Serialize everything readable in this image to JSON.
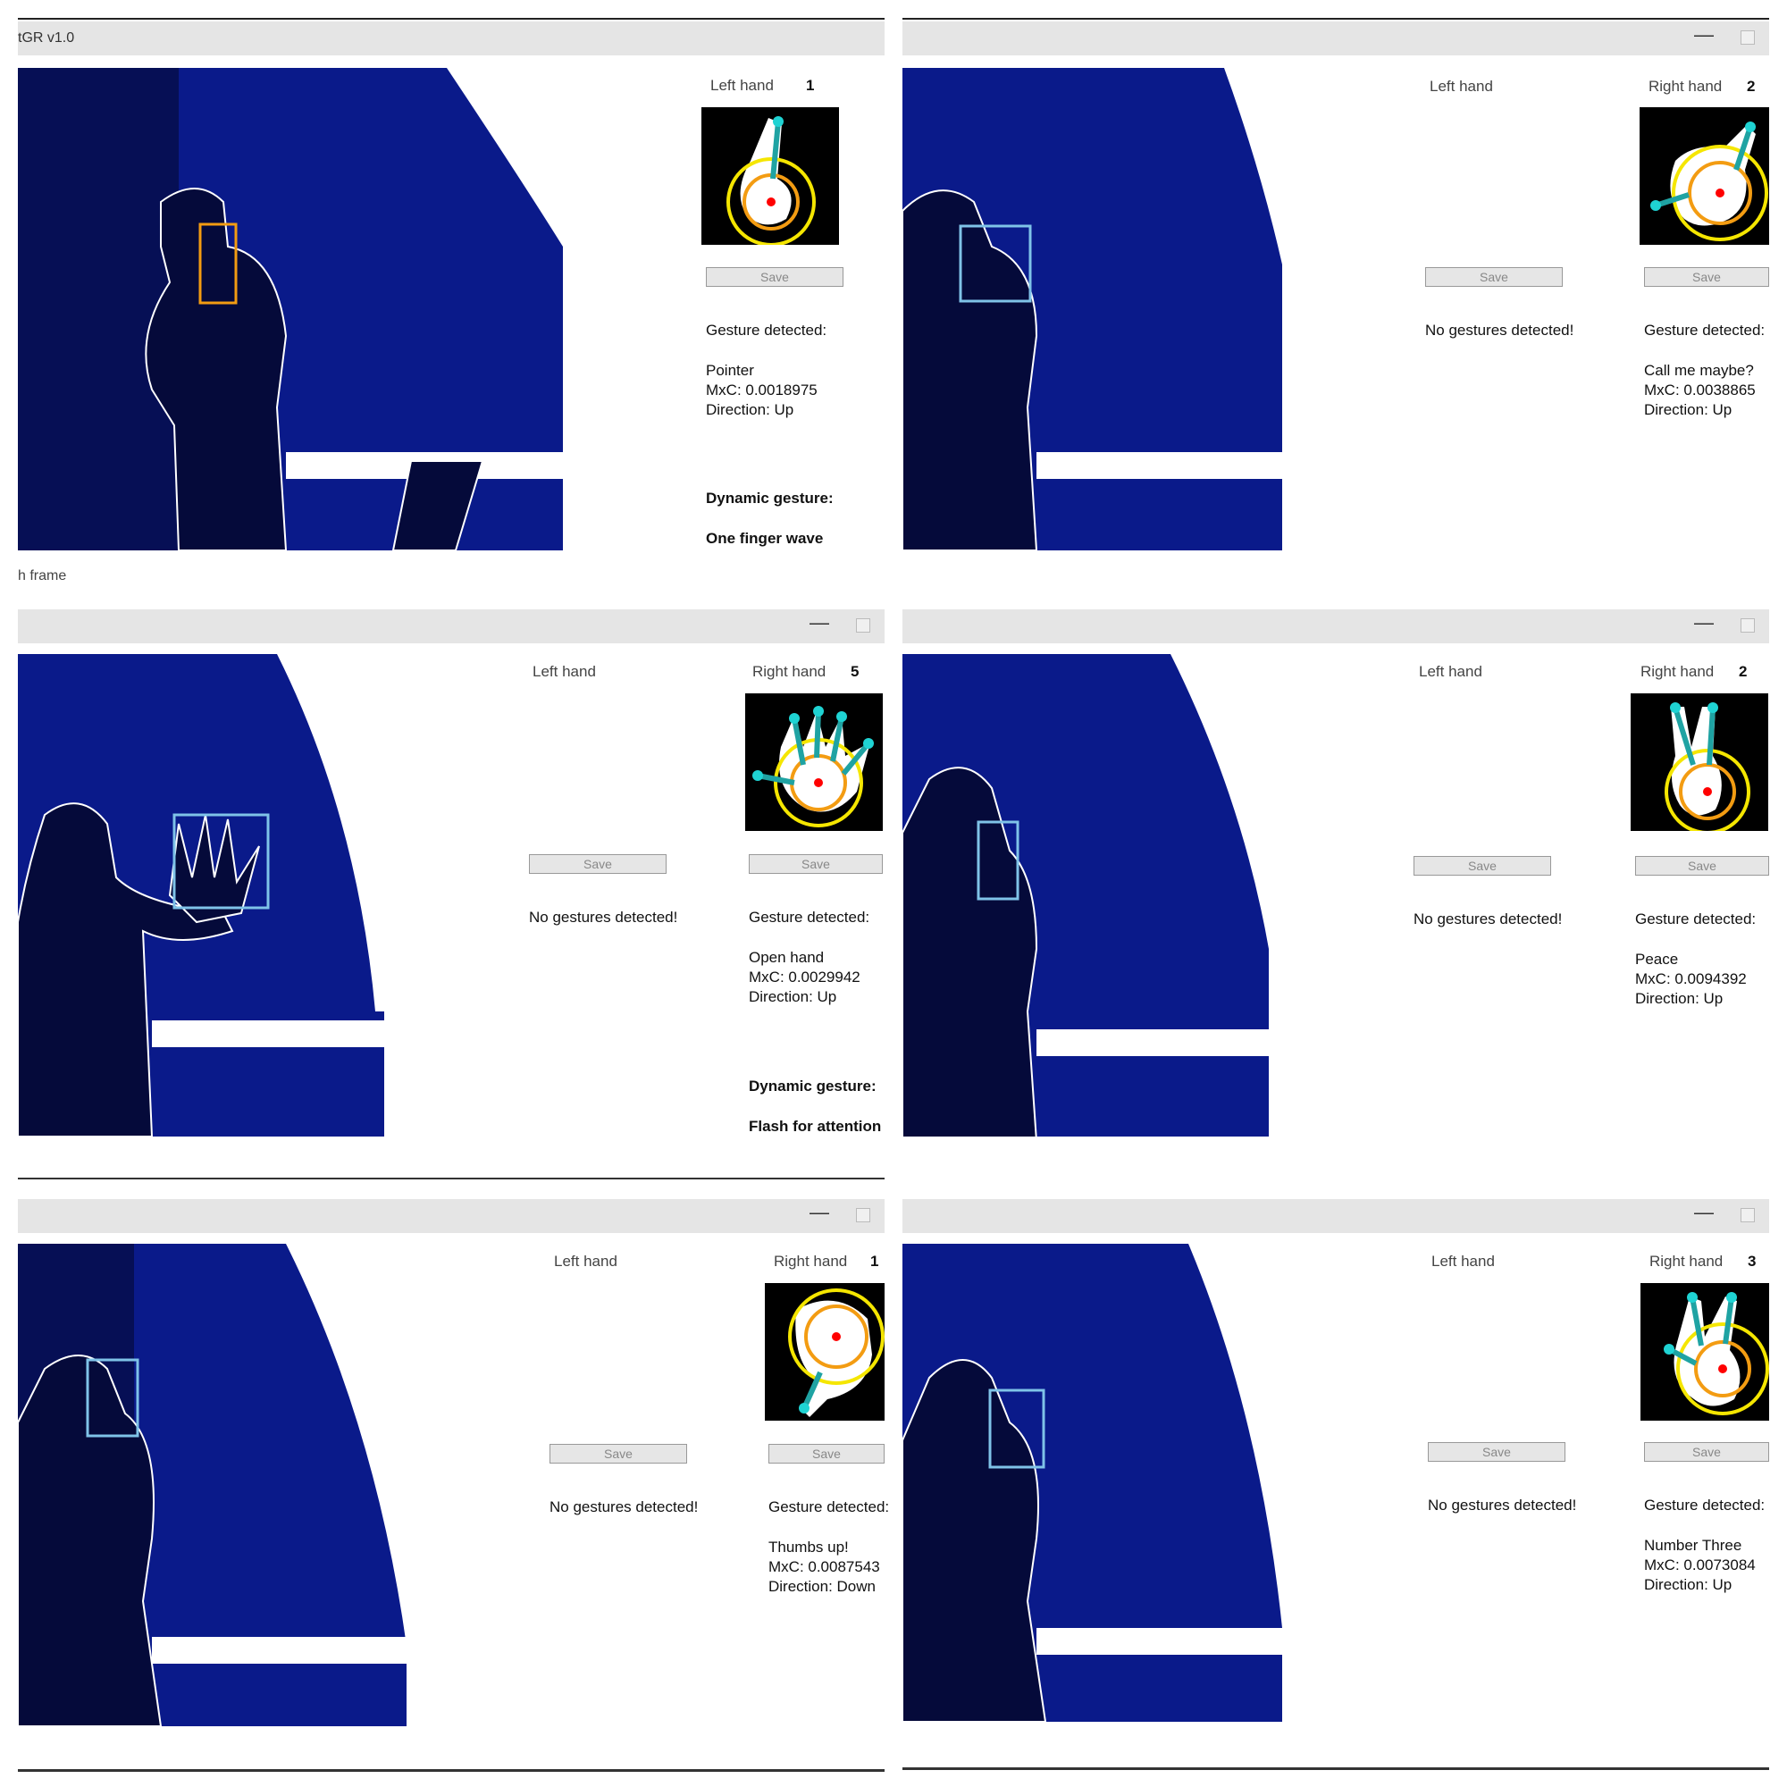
{
  "app": {
    "title": "tGR v1.0",
    "status_text": "h frame"
  },
  "common": {
    "left_hand": "Left hand",
    "right_hand": "Right hand",
    "save": "Save",
    "no_gestures": "No gestures detected!",
    "gesture_detected": "Gesture detected:",
    "dynamic_gesture": "Dynamic gesture:"
  },
  "panels": [
    {
      "count": "1",
      "gesture": "Pointer",
      "mxc": "MxC: 0.0018975",
      "direction": "Direction: Up",
      "dynamic_value": "One finger wave",
      "fingers": 1,
      "box_color": "#f39c12"
    },
    {
      "count": "2",
      "gesture": "Call me maybe?",
      "mxc": "MxC: 0.0038865",
      "direction": "Direction: Up",
      "fingers": 2,
      "box_color": "#7fc3e8"
    },
    {
      "count": "5",
      "gesture": "Open hand",
      "mxc": "MxC: 0.0029942",
      "direction": "Direction: Up",
      "dynamic_value": "Flash for attention",
      "fingers": 5,
      "box_color": "#7fc3e8"
    },
    {
      "count": "2",
      "gesture": "Peace",
      "mxc": "MxC: 0.0094392",
      "direction": "Direction: Up",
      "fingers": 2,
      "box_color": "#7fc3e8"
    },
    {
      "count": "1",
      "gesture": "Thumbs up!",
      "mxc": "MxC: 0.0087543",
      "direction": "Direction: Down",
      "fingers": 1,
      "box_color": "#7fc3e8"
    },
    {
      "count": "3",
      "gesture": "Number Three",
      "mxc": "MxC: 0.0073084",
      "direction": "Direction: Up",
      "fingers": 3,
      "box_color": "#7fc3e8"
    }
  ],
  "colors": {
    "depth_bg": "#0a1a8a",
    "silhouette": "#050a3a",
    "accent_yellow": "#f5e600",
    "accent_orange": "#f39c12",
    "fingertip": "#1fd3d3",
    "centroid": "#ff0000"
  }
}
